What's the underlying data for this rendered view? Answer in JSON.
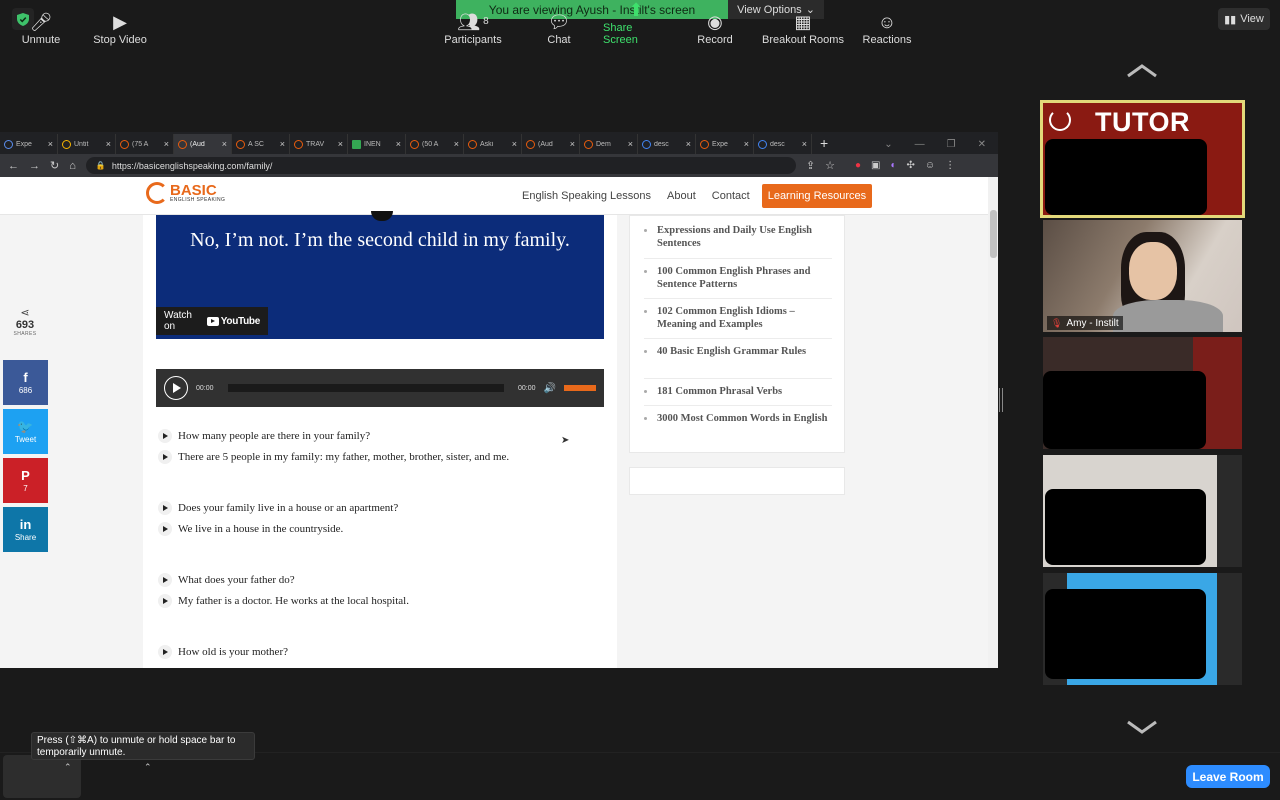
{
  "zoom": {
    "viewing_text": "You are viewing Ayush - Instilt's screen",
    "view_options": "View Options",
    "view_label": "View",
    "tooltip": "Press  (⇧⌘A) to unmute or hold space bar to temporarily unmute.",
    "controls": {
      "unmute": "Unmute",
      "stop_video": "Stop Video",
      "participants": "Participants",
      "participants_count": "8",
      "chat": "Chat",
      "share_screen": "Share Screen",
      "record": "Record",
      "breakout_rooms": "Breakout Rooms",
      "reactions": "Reactions",
      "leave_room": "Leave Room"
    },
    "tiles": {
      "tutor_label": "TUTOR",
      "amy_name": "Amy - Instilt"
    },
    "accent": "#2d8cff",
    "banner_color": "#3eb25f"
  },
  "browser": {
    "tabs": [
      {
        "label": "Expe",
        "icon": "b"
      },
      {
        "label": "Untit",
        "icon": "y"
      },
      {
        "label": "(75 A",
        "icon": "o"
      },
      {
        "label": "(Aud",
        "icon": "o",
        "active": true
      },
      {
        "label": "A SC",
        "icon": "o"
      },
      {
        "label": "TRAV",
        "icon": "o"
      },
      {
        "label": "INEN",
        "icon": "x"
      },
      {
        "label": "(50 A",
        "icon": "o"
      },
      {
        "label": "Aski",
        "icon": "o"
      },
      {
        "label": "(Aud",
        "icon": "o"
      },
      {
        "label": "Dem",
        "icon": "o"
      },
      {
        "label": "desc",
        "icon": "g"
      },
      {
        "label": "Expe",
        "icon": "o"
      },
      {
        "label": "desc",
        "icon": "g"
      }
    ],
    "url": "https://basicenglishspeaking.com/family/"
  },
  "site": {
    "logo_big": "BASIC",
    "logo_small": "ENGLISH SPEAKING",
    "nav": [
      "English Speaking Lessons",
      "About",
      "Contact"
    ],
    "nav_cta": "Learning Resources",
    "video_caption": "No, I’m not. I’m the second child in my family.",
    "watch_on": "Watch on",
    "youtube": "YouTube",
    "audio_start": "00:00",
    "audio_end": "00:00",
    "qa": [
      "How many people are there in your family?",
      "There are 5 people in my family: my father, mother, brother, sister, and me.",
      "Does your family live in a house or an apartment?",
      "We live in a house in the countryside.",
      "What does your father do?",
      "My father is a doctor. He works at the local hospital.",
      "How old is your mother?"
    ],
    "sidebar_links": [
      "Expressions and Daily Use English Sentences",
      "100 Common English Phrases and Sentence Patterns",
      "102 Common English Idioms – Meaning and Examples",
      "40 Basic English Grammar Rules",
      "181 Common Phrasal Verbs",
      "3000 Most Common Words in English"
    ],
    "shares_count": "693",
    "shares_label": "SHARES",
    "social": [
      {
        "icon": "f",
        "label": "686"
      },
      {
        "icon": "t",
        "label": "Tweet"
      },
      {
        "icon": "p",
        "label": "7"
      },
      {
        "icon": "in",
        "label": "Share"
      }
    ],
    "brand_color": "#e8691b"
  }
}
